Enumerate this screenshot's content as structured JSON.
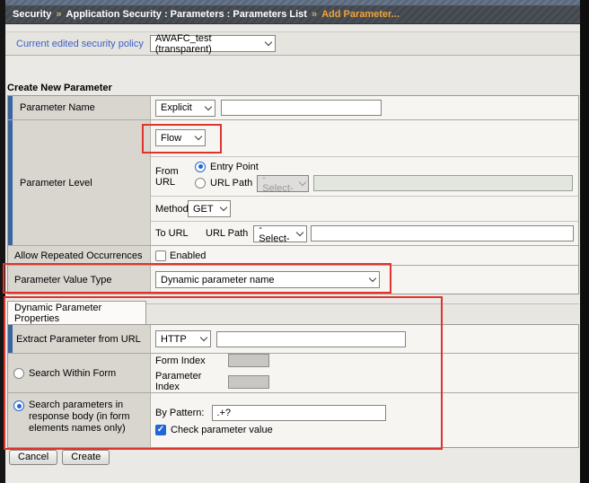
{
  "breadcrumb": {
    "section": "Security",
    "separator": "»",
    "path": "Application Security : Parameters : Parameters List",
    "current": "Add Parameter..."
  },
  "policy": {
    "label": "Current edited security policy",
    "selected_value": "AWAFC_test (transparent)"
  },
  "create_form": {
    "title": "Create New Parameter",
    "parameter_name": {
      "label": "Parameter Name",
      "type_selected": "Explicit",
      "name_value": ""
    },
    "parameter_level": {
      "label": "Parameter Level",
      "level_selected": "Flow",
      "from_url": {
        "label": "From URL",
        "entry_point_label": "Entry Point",
        "entry_point_selected": true,
        "url_path_label": "URL Path",
        "url_path_selected": false,
        "url_path_select": "-Select-",
        "url_path_value": ""
      },
      "method": {
        "label": "Method",
        "selected": "GET"
      },
      "to_url": {
        "label": "To URL",
        "url_path_label": "URL Path",
        "url_path_select": "-Select-",
        "url_value": ""
      }
    },
    "allow_repeated_occurrences": {
      "label": "Allow Repeated Occurrences",
      "checkbox_label": "Enabled",
      "checked": false
    },
    "parameter_value_type": {
      "label": "Parameter Value Type",
      "selected": "Dynamic parameter name"
    }
  },
  "dynamic_parameter_properties": {
    "tab_label": "Dynamic Parameter Properties",
    "extract_parameter_from_url": {
      "label": "Extract Parameter from URL",
      "protocol_selected": "HTTP",
      "url_value": ""
    },
    "search_within_form": {
      "label": "Search Within Form",
      "selected": false,
      "form_index_label": "Form Index",
      "form_index_value": "",
      "parameter_index_label": "Parameter Index",
      "parameter_index_value": ""
    },
    "search_in_response_body": {
      "label": "Search parameters in response body (in form elements names only)",
      "selected": true,
      "by_pattern_label": "By Pattern:",
      "pattern_value": ".+?",
      "check_parameter_value_label": "Check parameter value",
      "checked": true
    }
  },
  "actions": {
    "cancel": "Cancel",
    "create": "Create"
  },
  "check_glyph": "✓",
  "colors": {
    "accent_blue": "#38659e",
    "annotation_red": "#df342c",
    "breadcrumb_highlight": "#f2a33a",
    "policy_label_blue": "#3b5ec7"
  }
}
